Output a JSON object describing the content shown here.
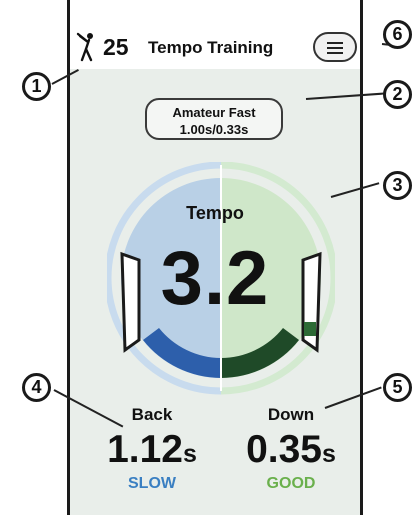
{
  "header": {
    "count": "25",
    "title": "Tempo Training",
    "icons": {
      "golfer": "golfer-swing-icon",
      "menu": "hamburger-menu-icon"
    }
  },
  "preset": {
    "name": "Amateur Fast",
    "ratio": "1.00s/0.33s"
  },
  "tempo": {
    "label": "Tempo",
    "value": "3.2"
  },
  "back": {
    "label": "Back",
    "value": "1.12",
    "unit": "s",
    "rating": "SLOW"
  },
  "down": {
    "label": "Down",
    "value": "0.35",
    "unit": "s",
    "rating": "GOOD"
  },
  "callouts": [
    "1",
    "2",
    "3",
    "4",
    "5",
    "6"
  ],
  "colors": {
    "back_fill": "#b9d0e6",
    "down_fill": "#cfe7c9",
    "back_bar": "#2d5fab",
    "down_bar": "#1f4a28",
    "slow": "#3a7fc2",
    "good": "#6ab04c"
  }
}
